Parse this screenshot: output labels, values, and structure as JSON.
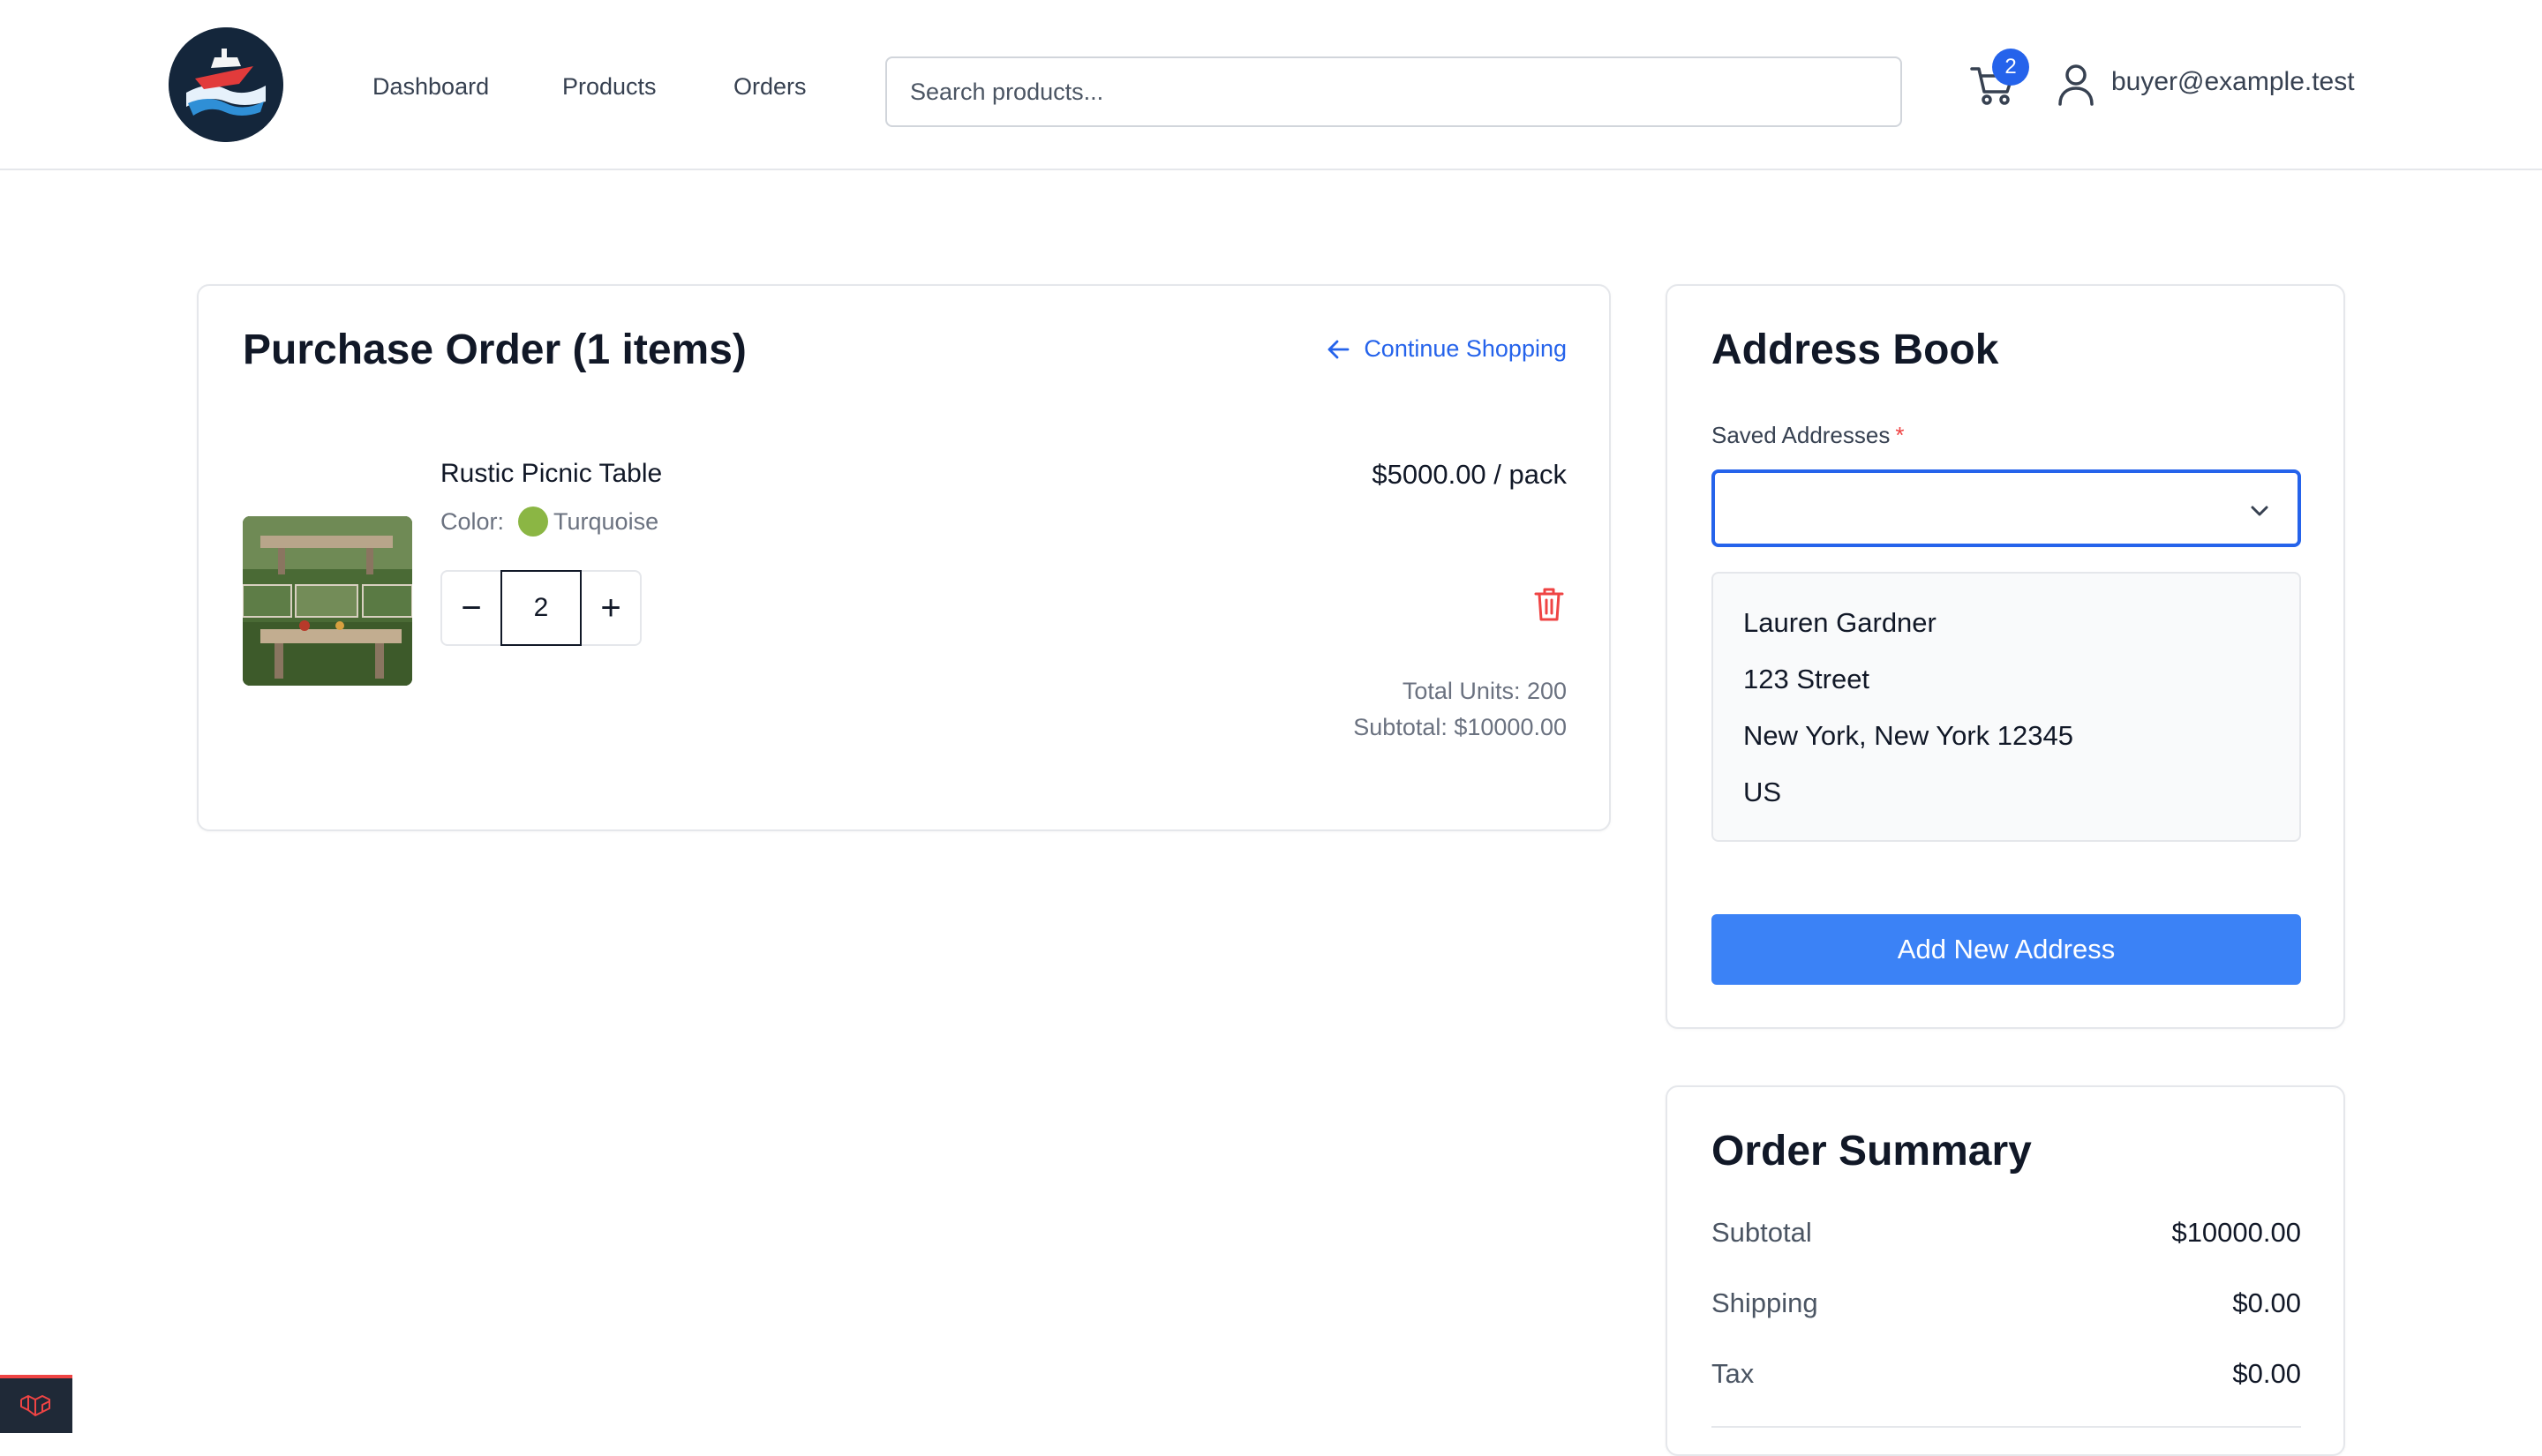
{
  "header": {
    "nav": [
      {
        "label": "Dashboard"
      },
      {
        "label": "Products"
      },
      {
        "label": "Orders"
      }
    ],
    "search": {
      "placeholder": "Search products...",
      "value": ""
    },
    "cart": {
      "count": "2",
      "icon": "cart-icon"
    },
    "user": {
      "email": "buyer@example.test",
      "icon": "user-icon"
    }
  },
  "purchase_order": {
    "title": "Purchase Order (1 items)",
    "continue_label": "Continue Shopping",
    "item": {
      "name": "Rustic Picnic Table",
      "color_label": "Color:",
      "color_name": "Turquoise",
      "color_swatch": "#8bb644",
      "price": "$5000.00 / pack",
      "quantity": "2",
      "decrement": "−",
      "increment": "+",
      "total_units": "Total Units: 200",
      "subtotal": "Subtotal: $10000.00"
    }
  },
  "address_book": {
    "title": "Address Book",
    "saved_label": "Saved Addresses",
    "required_mark": "*",
    "selected": "",
    "address": {
      "name": "Lauren Gardner",
      "street": "123 Street",
      "city_line": "New York, New York 12345",
      "country": "US"
    },
    "add_button": "Add New Address"
  },
  "order_summary": {
    "title": "Order Summary",
    "rows": [
      {
        "label": "Subtotal",
        "value": "$10000.00"
      },
      {
        "label": "Shipping",
        "value": "$0.00"
      },
      {
        "label": "Tax",
        "value": "$0.00"
      }
    ]
  },
  "colors": {
    "accent": "#2563eb",
    "button": "#3b82f6",
    "danger": "#ef4444"
  }
}
